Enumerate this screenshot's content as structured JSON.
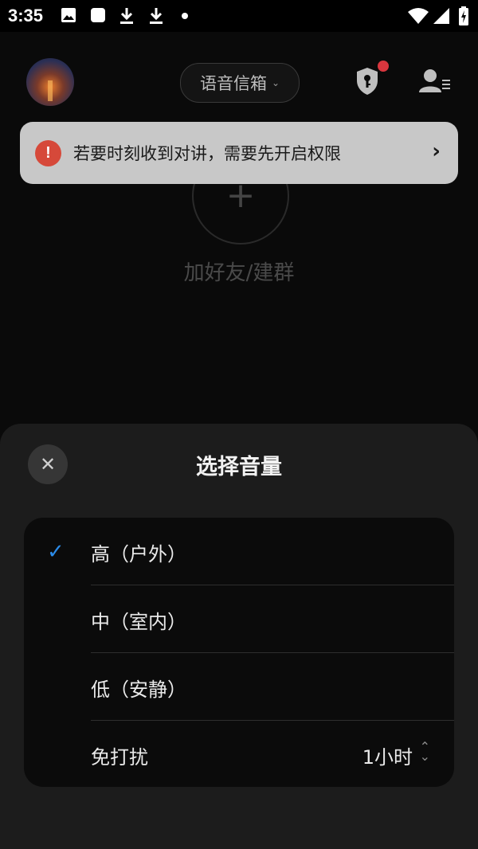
{
  "status_bar": {
    "time": "3:35",
    "icons_left": [
      "image-icon",
      "square-app-icon",
      "download-icon",
      "download-icon",
      "dot-icon"
    ],
    "icons_right": [
      "wifi-icon",
      "signal-icon",
      "battery-charging-icon"
    ]
  },
  "header": {
    "mailbox_label": "语音信箱",
    "notification_dot_color": "#d9363e"
  },
  "banner": {
    "text": "若要时刻收到对讲，需要先开启权限",
    "icon": "!",
    "arrow": "›"
  },
  "empty_state": {
    "add_label": "加好友/建群",
    "plus": "+"
  },
  "sheet": {
    "title": "选择音量",
    "close": "✕",
    "options": [
      {
        "label": "高（户外）",
        "selected": true,
        "check": "✓"
      },
      {
        "label": "中（室内）",
        "selected": false
      },
      {
        "label": "低（安静）",
        "selected": false
      }
    ],
    "dnd": {
      "label": "免打扰",
      "value": "1小时"
    },
    "accent_color": "#2b8be8"
  }
}
